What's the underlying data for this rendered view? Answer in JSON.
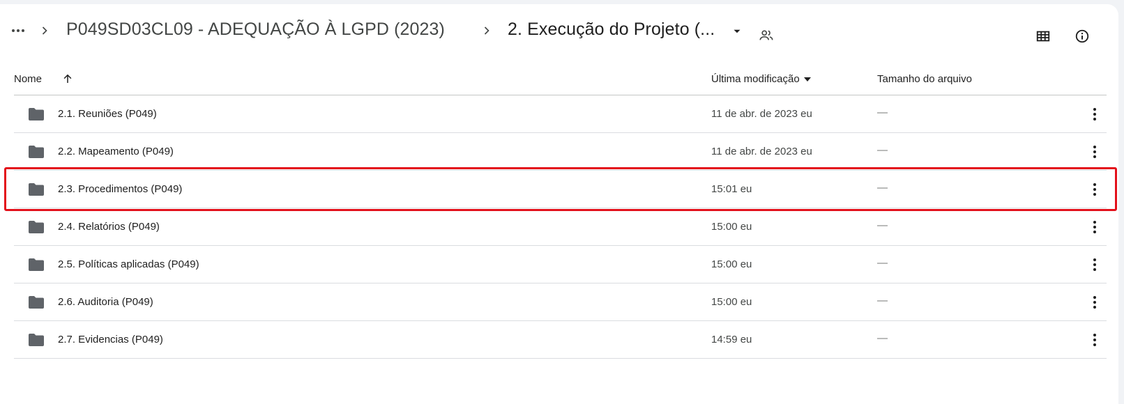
{
  "breadcrumb": {
    "parent": "P049SD03CL09 - ADEQUAÇÃO À LGPD (2023)",
    "current": "2. Execução do Projeto (..."
  },
  "icons": {
    "more": "more-horiz-icon",
    "separator": "chevron-right-icon",
    "dropdown": "arrow-drop-down-icon",
    "shared": "people-icon",
    "view": "grid-view-icon",
    "info": "info-icon",
    "folder": "folder-icon",
    "row_menu": "more-vert-icon",
    "sort": "arrow-upward-icon"
  },
  "table": {
    "headers": {
      "name": "Nome",
      "modified": "Última modificação",
      "size": "Tamanho do arquivo"
    },
    "rows": [
      {
        "name": "2.1. Reuniões (P049)",
        "modified": "11 de abr. de 2023 eu",
        "size": "—"
      },
      {
        "name": "2.2. Mapeamento (P049)",
        "modified": "11 de abr. de 2023 eu",
        "size": "—"
      },
      {
        "name": "2.3. Procedimentos (P049)",
        "modified": "15:01 eu",
        "size": "—"
      },
      {
        "name": "2.4. Relatórios (P049)",
        "modified": "15:00 eu",
        "size": "—"
      },
      {
        "name": "2.5. Políticas aplicadas (P049)",
        "modified": "15:00 eu",
        "size": "—"
      },
      {
        "name": "2.6. Auditoria (P049)",
        "modified": "15:00 eu",
        "size": "—"
      },
      {
        "name": "2.7. Evidencias (P049)",
        "modified": "14:59 eu",
        "size": "—"
      }
    ]
  },
  "colors": {
    "highlight": "#e3111b",
    "folder": "#5f6368"
  }
}
